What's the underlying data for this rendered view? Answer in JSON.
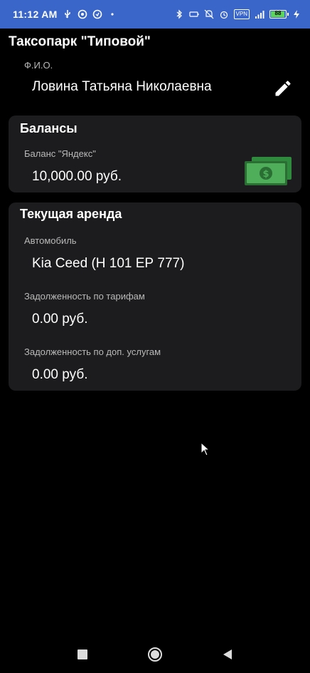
{
  "status_bar": {
    "time": "11:12 AM",
    "battery": "88",
    "vpn": "VPN",
    "colors": {
      "background": "#3a66c9"
    }
  },
  "app": {
    "title": "Таксопарк \"Типовой\""
  },
  "profile": {
    "fio_label": "Ф.И.О.",
    "fio_value": "Ловина Татьяна Николаевна",
    "edit_icon": "pencil-icon"
  },
  "balances": {
    "title": "Балансы",
    "yandex_label": "Баланс \"Яндекс\"",
    "yandex_value": "10,000.00 руб.",
    "icon": "money-icon"
  },
  "rent": {
    "title": "Текущая аренда",
    "car_label": "Автомобиль",
    "car_value": "Kia Ceed (Н 101 ЕР 777)",
    "tariff_debt_label": "Задолженность по тарифам",
    "tariff_debt_value": "0.00 руб.",
    "services_debt_label": "Задолженность по доп. услугам",
    "services_debt_value": "0.00 руб."
  },
  "colors": {
    "card_bg": "#1c1c1e",
    "label": "#b9b9b9",
    "money_green": "#3fa34d"
  }
}
